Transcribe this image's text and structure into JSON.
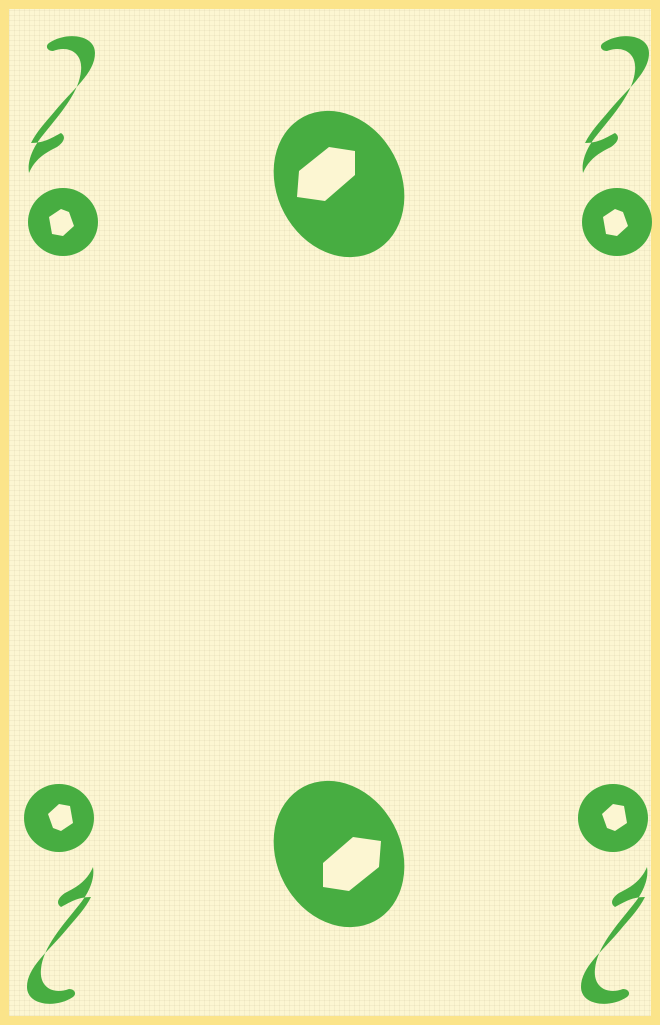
{
  "card": {
    "rank": "2",
    "suit": "oros",
    "suit_icon": "coin-icon",
    "ink_color": "#47ad41",
    "face_color": "#fcf6d2",
    "border_color": "#fbe48a"
  }
}
